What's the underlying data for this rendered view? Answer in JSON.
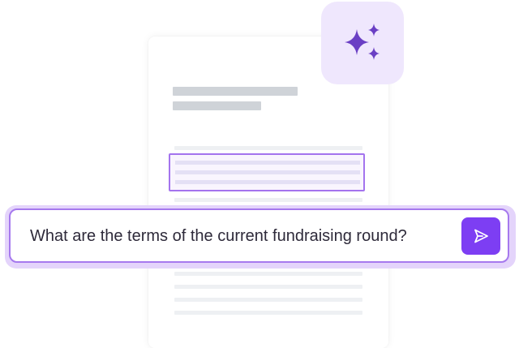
{
  "prompt": {
    "query_text": "What are the terms of the current fundraising round?"
  },
  "icons": {
    "ai": "sparkles-icon",
    "send": "send-arrow-icon"
  },
  "colors": {
    "accent": "#7d3ef3",
    "highlight_border": "#a474ee",
    "tile_bg": "#efe7fd"
  }
}
